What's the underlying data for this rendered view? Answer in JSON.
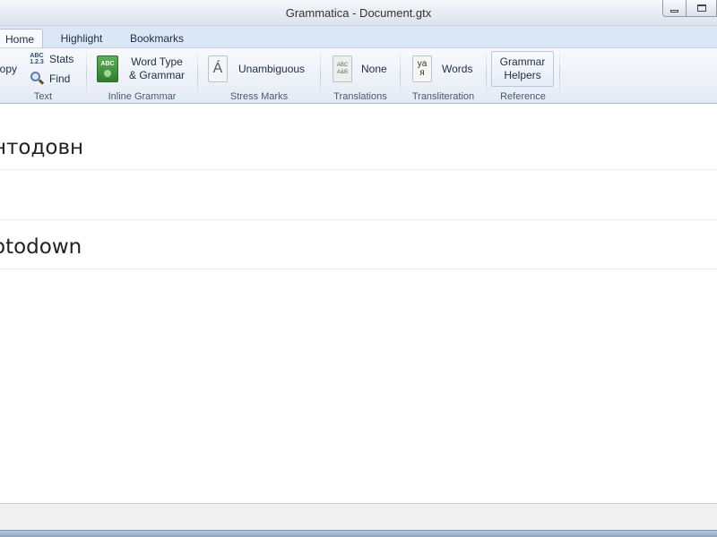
{
  "window": {
    "title": "Grammatica - Document.gtx"
  },
  "tabs": [
    {
      "label": "Home",
      "active": true
    },
    {
      "label": "Highlight",
      "active": false
    },
    {
      "label": "Bookmarks",
      "active": false
    }
  ],
  "ribbon": {
    "text_group": {
      "label": "Text",
      "copy_label": "Copy",
      "stats_label": "Stats",
      "stats_icon_text": "ABC 1.2.3",
      "find_label": "Find"
    },
    "inline_grammar": {
      "label": "Inline Grammar",
      "button_line1": "Word Type",
      "button_line2": "& Grammar",
      "icon_text": "ABC"
    },
    "stress_marks": {
      "label": "Stress Marks",
      "button_label": "Unambiguous",
      "icon_text": "Á"
    },
    "translations": {
      "label": "Translations",
      "button_label": "None",
      "icon_text": "ABC A&B"
    },
    "transliteration": {
      "label": "Transliteration",
      "button_label": "Words",
      "icon_top": "ya",
      "icon_bottom": "я"
    },
    "reference": {
      "label": "Reference",
      "button_line1": "Grammar",
      "button_line2": "Helpers"
    }
  },
  "document": {
    "lines": [
      "нтодовн",
      "",
      "otodown"
    ]
  },
  "colors": {
    "tab_bar": "#dbe7f6",
    "ribbon_bg": "#eef2f8",
    "grammar_icon": "#2e7e2c"
  }
}
